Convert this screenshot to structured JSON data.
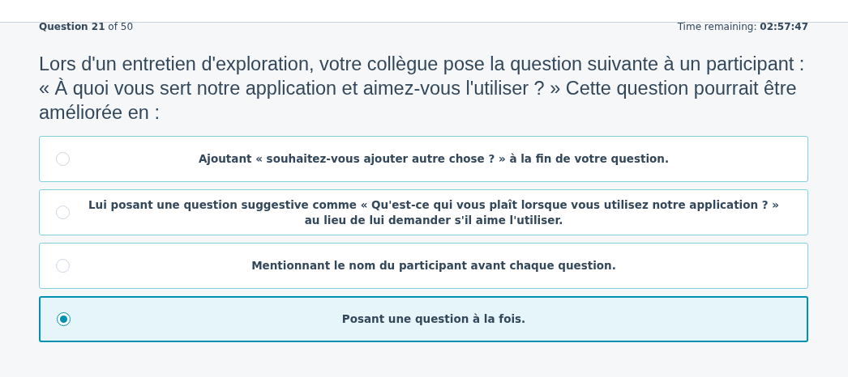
{
  "progress": {
    "label": "Question",
    "number": "21",
    "of": "of 50"
  },
  "timer": {
    "label": "Time remaining:",
    "value": "02:57:47"
  },
  "question": "Lors d'un entretien d'exploration, votre collègue pose la question suivante à un participant : « À quoi vous sert notre application et aimez-vous l'utiliser ? » Cette question pourrait être améliorée en :",
  "options": [
    {
      "text": "Ajoutant « souhaitez-vous ajouter autre chose ? » à la fin de votre question.",
      "selected": false
    },
    {
      "text": "Lui posant une question suggestive comme « Qu'est-ce qui vous plaît lorsque vous utilisez notre application ? » au lieu de lui demander s'il aime l'utiliser.",
      "selected": false
    },
    {
      "text": "Mentionnant le nom du participant avant chaque question.",
      "selected": false
    },
    {
      "text": "Posant une question à la fois.",
      "selected": true
    }
  ]
}
